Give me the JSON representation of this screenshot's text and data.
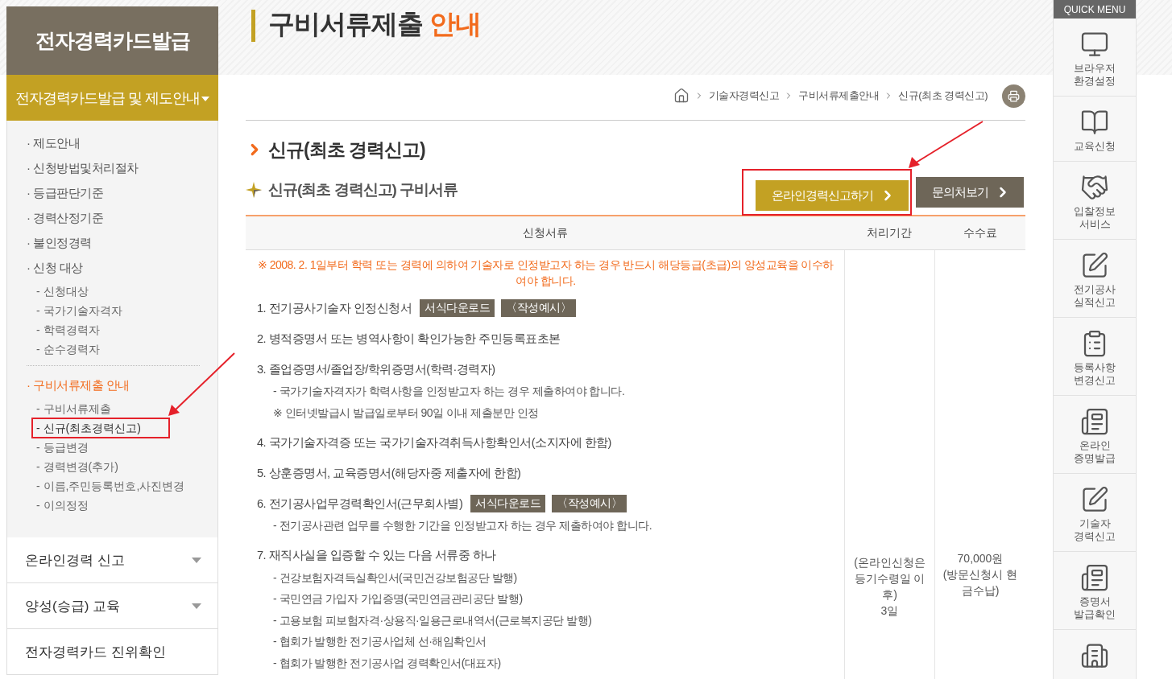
{
  "sidebar": {
    "title": "전자경력카드발급",
    "section": {
      "label": "전자경력카드발급 및 제도안내",
      "expanded": true
    },
    "items": [
      {
        "label": "· 제도안내",
        "selected": false
      },
      {
        "label": "· 신청방법및처리절차",
        "selected": false
      },
      {
        "label": "· 등급판단기준",
        "selected": false
      },
      {
        "label": "· 경력산정기준",
        "selected": false
      },
      {
        "label": "· 불인정경력",
        "selected": false
      },
      {
        "label": "· 신청 대상",
        "selected": false,
        "children": [
          {
            "label": "- 신청대상",
            "selected": false,
            "annotated": false
          },
          {
            "label": "- 국가기술자격자",
            "selected": false,
            "annotated": false
          },
          {
            "label": "- 학력경력자",
            "selected": false,
            "annotated": false
          },
          {
            "label": "- 순수경력자",
            "selected": false,
            "annotated": false
          }
        ]
      },
      {
        "label": "· 구비서류제출 안내",
        "selected": true,
        "children": [
          {
            "label": "- 구비서류제출",
            "selected": false,
            "annotated": false
          },
          {
            "label": "- 신규(최초경력신고)",
            "selected": true,
            "annotated": true
          },
          {
            "label": "- 등급변경",
            "selected": false,
            "annotated": false
          },
          {
            "label": "- 경력변경(추가)",
            "selected": false,
            "annotated": false
          },
          {
            "label": "- 이름,주민등록번호,사진변경",
            "selected": false,
            "annotated": false
          },
          {
            "label": "- 이의정정",
            "selected": false,
            "annotated": false
          }
        ]
      }
    ],
    "accordion": [
      {
        "label": "온라인경력 신고",
        "expandable": true
      },
      {
        "label": "양성(승급) 교육",
        "expandable": true
      },
      {
        "label": "전자경력카드 진위확인",
        "expandable": false
      }
    ]
  },
  "page_title": {
    "text": "구비서류제출",
    "accent": "안내"
  },
  "breadcrumb": [
    "기술자경력신고",
    "구비서류제출안내",
    "신규(최초 경력신고)"
  ],
  "heading": "신규(최초 경력신고)",
  "subheading": "신규(최초 경력신고) 구비서류",
  "buttons": [
    {
      "label": "온라인경력신고하기",
      "kind": "primary",
      "annotated": true
    },
    {
      "label": "문의처보기",
      "kind": "secondary",
      "annotated": false
    }
  ],
  "table": {
    "columns": [
      "신청서류",
      "처리기간",
      "수수료"
    ],
    "notice": "※ 2008. 2. 1일부터 학력 또는 경력에 의하여 기술자로 인정받고자 하는 경우 반드시 해당등급(초급)의 양성교육을 이수하여야 합니다.",
    "documents": [
      {
        "label": "1. 전기공사기술자 인정신청서",
        "buttons": [
          "서식다운로드",
          "〈작성예시〉"
        ]
      },
      {
        "label": "2. 병적증명서 또는 병역사항이 확인가능한 주민등록표초본"
      },
      {
        "label": "3. 졸업증명서/졸업장/학위증명서(학력·경력자)",
        "notes": [
          "- 국가기술자격자가 학력사항을 인정받고자 하는 경우 제출하여야 합니다.",
          "※ 인터넷발급시 발급일로부터 90일 이내 제출분만 인정"
        ]
      },
      {
        "label": "4. 국가기술자격증 또는 국가기술자격취득사항확인서(소지자에 한함)"
      },
      {
        "label": "5. 상훈증명서, 교육증명서(해당자중 제출자에 한함)"
      },
      {
        "label": "6. 전기공사업무경력확인서(근무회사별)",
        "buttons": [
          "서식다운로드",
          "〈작성예시〉"
        ],
        "notes": [
          "- 전기공사관련 업무를 수행한 기간을 인정받고자 하는 경우 제출하여야 합니다."
        ]
      },
      {
        "label": "7. 재직사실을 입증할 수 있는 다음 서류중 하나",
        "notes": [
          "- 건강보험자격득실확인서(국민건강보험공단 발행)",
          "- 국민연금 가입자 가입증명(국민연금관리공단 발행)",
          "- 고용보험 피보험자격·상용직·일용근로내역서(근로복지공단 발행)",
          "- 협회가 발행한 전기공사업체 선·해임확인서",
          "- 협회가 발행한 전기공사업 경력확인서(대표자)"
        ]
      }
    ],
    "period": [
      "(온라인신청은 등기수령일 이후)",
      "3일"
    ],
    "fee": [
      "70,000원",
      "(방문신청시 현금수납)"
    ]
  },
  "quick_menu": {
    "title": "QUICK MENU",
    "items": [
      {
        "kind": "monitor",
        "lines": [
          "브라우저",
          "환경설정"
        ]
      },
      {
        "kind": "book",
        "lines": [
          "교육신청"
        ]
      },
      {
        "kind": "handshake",
        "lines": [
          "입찰정보",
          "서비스"
        ]
      },
      {
        "kind": "edit",
        "lines": [
          "전기공사",
          "실적신고"
        ]
      },
      {
        "kind": "clipboard",
        "lines": [
          "등록사항",
          "변경신고"
        ]
      },
      {
        "kind": "document",
        "lines": [
          "온라인",
          "증명발급"
        ]
      },
      {
        "kind": "edit",
        "lines": [
          "기술자",
          "경력신고"
        ]
      },
      {
        "kind": "document",
        "lines": [
          "증명서",
          "발급확인"
        ]
      },
      {
        "kind": "building"
      }
    ]
  }
}
